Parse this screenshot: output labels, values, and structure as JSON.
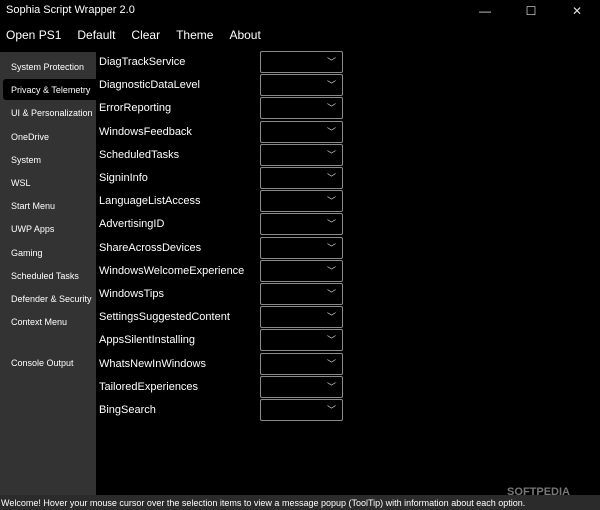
{
  "window": {
    "title": "Sophia Script Wrapper 2.0",
    "minimize": "—",
    "maximize": "☐",
    "close": "✕"
  },
  "menu": [
    "Open PS1",
    "Default",
    "Clear",
    "Theme",
    "About"
  ],
  "sidebar": {
    "items": [
      "System Protection",
      "Privacy & Telemetry",
      "UI & Personalization",
      "OneDrive",
      "System",
      "WSL",
      "Start Menu",
      "UWP Apps",
      "Gaming",
      "Scheduled Tasks",
      "Defender & Security",
      "Context Menu"
    ],
    "selected": "Privacy & Telemetry",
    "console": "Console Output"
  },
  "options": [
    "DiagTrackService",
    "DiagnosticDataLevel",
    "ErrorReporting",
    "WindowsFeedback",
    "ScheduledTasks",
    "SigninInfo",
    "LanguageListAccess",
    "AdvertisingID",
    "ShareAcrossDevices",
    "WindowsWelcomeExperience",
    "WindowsTips",
    "SettingsSuggestedContent",
    "AppsSilentInstalling",
    "WhatsNewInWindows",
    "TailoredExperiences",
    "BingSearch"
  ],
  "dropdown_icon": "chevron-down-icon",
  "status": "Welcome! Hover your mouse cursor over the selection items to view a message popup (ToolTip) with information about each option.",
  "watermark": "SOFTPEDIA"
}
